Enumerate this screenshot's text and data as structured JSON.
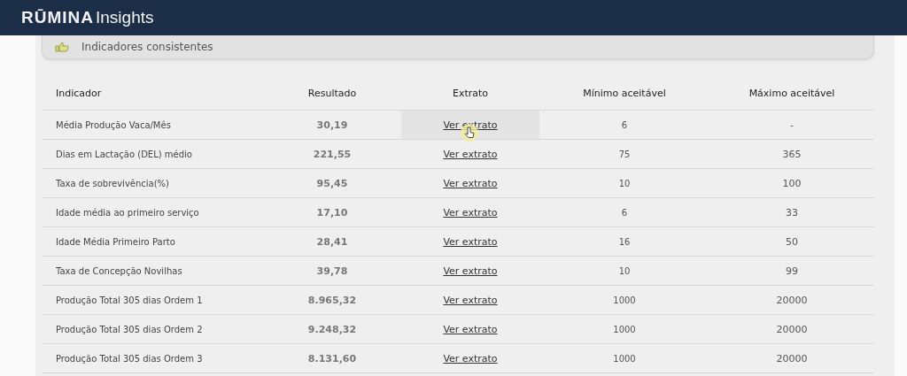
{
  "header": {
    "brand": "RŪMINA",
    "brand_suffix": "Insights"
  },
  "summary_card": {
    "label": "Indicadores consistentes"
  },
  "table": {
    "columns": [
      "Indicador",
      "Resultado",
      "Extrato",
      "Mínimo aceitável",
      "Máximo aceitável"
    ],
    "rows": [
      {
        "indicator": "Média Produção Vaca/Mês",
        "result": "30,19",
        "link": "Ver extrato",
        "min": "6",
        "max": "-",
        "hovered": true
      },
      {
        "indicator": "Dias em Lactação (DEL) médio",
        "result": "221,55",
        "link": "Ver extrato",
        "min": "75",
        "max": "365",
        "hovered": false
      },
      {
        "indicator": "Taxa de sobrevivência(%)",
        "result": "95,45",
        "link": "Ver extrato",
        "min": "10",
        "max": "100",
        "hovered": false
      },
      {
        "indicator": "Idade média ao primeiro serviço",
        "result": "17,10",
        "link": "Ver extrato",
        "min": "6",
        "max": "33",
        "hovered": false
      },
      {
        "indicator": "Idade Média Primeiro Parto",
        "result": "28,41",
        "link": "Ver extrato",
        "min": "16",
        "max": "50",
        "hovered": false
      },
      {
        "indicator": "Taxa de Concepção Novilhas",
        "result": "39,78",
        "link": "Ver extrato",
        "min": "10",
        "max": "99",
        "hovered": false
      },
      {
        "indicator": "Produção Total 305 dias Ordem 1",
        "result": "8.965,32",
        "link": "Ver extrato",
        "min": "1000",
        "max": "20000",
        "hovered": false
      },
      {
        "indicator": "Produção Total 305 dias Ordem 2",
        "result": "9.248,32",
        "link": "Ver extrato",
        "min": "1000",
        "max": "20000",
        "hovered": false
      },
      {
        "indicator": "Produção Total 305 dias Ordem 3",
        "result": "8.131,60",
        "link": "Ver extrato",
        "min": "1000",
        "max": "20000",
        "hovered": false
      }
    ]
  }
}
